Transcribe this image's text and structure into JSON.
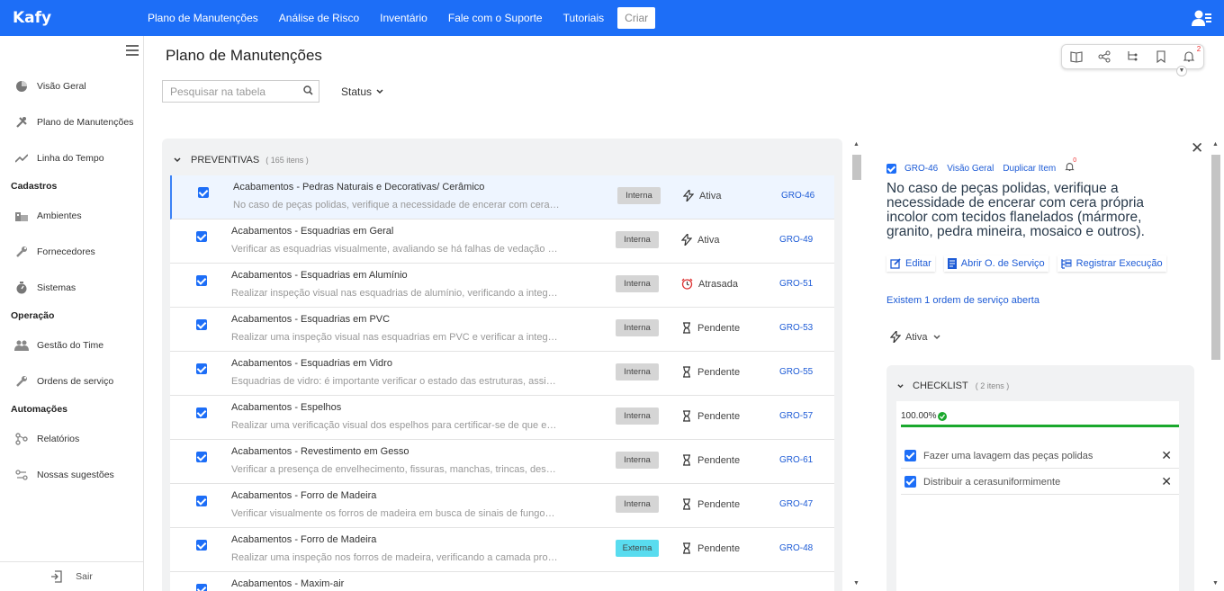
{
  "brand": "Kafy",
  "topnav": [
    "Plano de Manutenções",
    "Análise de Risco",
    "Inventário",
    "Fale com o Suporte",
    "Tutoriais",
    "Criar"
  ],
  "sidebar": {
    "items_top": [
      {
        "label": "Visão Geral",
        "icon": "pie-chart-icon"
      },
      {
        "label": "Plano de Manutenções",
        "icon": "tools-icon"
      },
      {
        "label": "Linha do Tempo",
        "icon": "trend-line-icon"
      }
    ],
    "cadastros_head": "Cadastros",
    "cadastros": [
      {
        "label": "Ambientes",
        "icon": "building-icon"
      },
      {
        "label": "Fornecedores",
        "icon": "wrench-icon"
      },
      {
        "label": "Sistemas",
        "icon": "gauge-icon"
      }
    ],
    "operacao_head": "Operação",
    "operacao": [
      {
        "label": "Gestão do Time",
        "icon": "team-icon"
      },
      {
        "label": "Ordens de serviço",
        "icon": "wrench-icon"
      }
    ],
    "automacoes_head": "Automações",
    "automacoes": [
      {
        "label": "Relatórios",
        "icon": "flow-icon"
      },
      {
        "label": "Nossas sugestões",
        "icon": "suggestion-icon"
      }
    ],
    "logout": "Sair"
  },
  "page": {
    "title": "Plano de Manutenções",
    "search_placeholder": "Pesquisar na tabela",
    "status_filter": "Status"
  },
  "toolbar": {
    "notification_count": "2"
  },
  "list": {
    "group": "PREVENTIVAS",
    "count": "( 165 itens )",
    "rows": [
      {
        "title": "Acabamentos - Pedras Naturais e Decorativas/ Cerâmico",
        "desc": "No caso de peças polidas, verifique a necessidade de encerar com cera própria incolor com tecidos flanelados",
        "type": "Interna",
        "status": "Ativa",
        "status_icon": "bolt",
        "code": "GRO-46"
      },
      {
        "title": "Acabamentos - Esquadrias em Geral",
        "desc": "Verificar as esquadrias visualmente, avaliando se há falhas de vedação e fixação",
        "type": "Interna",
        "status": "Ativa",
        "status_icon": "bolt",
        "code": "GRO-49"
      },
      {
        "title": "Acabamentos - Esquadrias em Alumínio",
        "desc": "Realizar inspeção visual nas esquadrias de alumínio, verificando a integridade",
        "type": "Interna",
        "status": "Atrasada",
        "status_icon": "alarm",
        "code": "GRO-51"
      },
      {
        "title": "Acabamentos - Esquadrias em PVC",
        "desc": "Realizar uma inspeção visual nas esquadrias em PVC e verificar a integridade",
        "type": "Interna",
        "status": "Pendente",
        "status_icon": "hourglass",
        "code": "GRO-53"
      },
      {
        "title": "Acabamentos - Esquadrias em Vidro",
        "desc": "Esquadrias de vidro: é importante verificar o estado das estruturas, assim como",
        "type": "Interna",
        "status": "Pendente",
        "status_icon": "hourglass",
        "code": "GRO-55"
      },
      {
        "title": "Acabamentos - Espelhos",
        "desc": "Realizar uma verificação visual dos espelhos para certificar-se de que estão",
        "type": "Interna",
        "status": "Pendente",
        "status_icon": "hourglass",
        "code": "GRO-57"
      },
      {
        "title": "Acabamentos - Revestimento em Gesso",
        "desc": "Verificar a presença de envelhecimento, fissuras, manchas, trincas, descascamentos",
        "type": "Interna",
        "status": "Pendente",
        "status_icon": "hourglass",
        "code": "GRO-61"
      },
      {
        "title": "Acabamentos - Forro de Madeira",
        "desc": "Verificar visualmente os forros de madeira em busca de sinais de fungos, cupins",
        "type": "Interna",
        "status": "Pendente",
        "status_icon": "hourglass",
        "code": "GRO-47"
      },
      {
        "title": "Acabamentos - Forro de Madeira",
        "desc": "Realizar uma inspeção nos forros de madeira, verificando a camada protetora",
        "type": "Externa",
        "status": "Pendente",
        "status_icon": "hourglass",
        "code": "GRO-48"
      },
      {
        "title": "Acabamentos - Maxim-air",
        "desc": "",
        "type": "",
        "status": "",
        "status_icon": "",
        "code": ""
      }
    ]
  },
  "detail": {
    "code": "GRO-46",
    "link_overview": "Visão Geral",
    "link_duplicate": "Duplicar Item",
    "notif_count": "0",
    "title": "No caso de peças polidas, verifique a necessidade de encerar com cera própria incolor com tecidos flanelados (mármore, granito, pedra mineira, mosaico e outros).",
    "btn_edit": "Editar",
    "btn_open_os": "Abrir O. de Serviço",
    "btn_register": "Registrar Execução",
    "os_link": "Existem 1 ordem de serviço aberta",
    "status": "Ativa",
    "checklist": {
      "head": "CHECKLIST",
      "count": "( 2 itens )",
      "progress_label": "100.00%",
      "progress": 1.0,
      "items": [
        "Fazer uma lavagem das peças polidas",
        "Distribuir a cerasuniformimente"
      ]
    }
  },
  "colors": {
    "primary": "#1d6ef7",
    "success": "#1aa82d",
    "external": "#59dcef"
  }
}
